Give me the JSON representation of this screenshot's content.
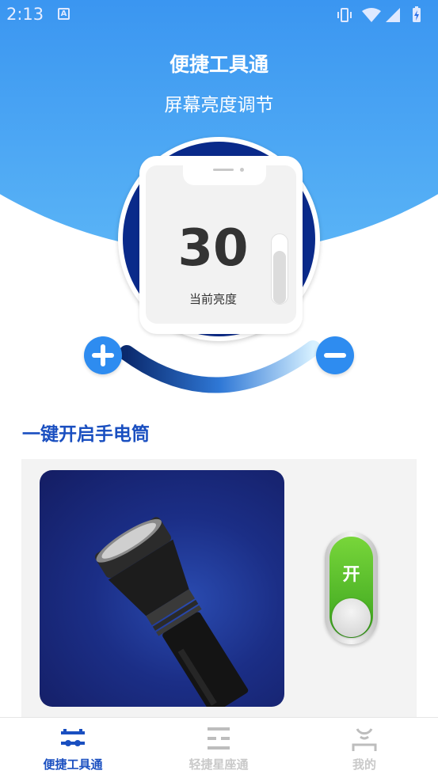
{
  "status_bar": {
    "time": "2:13",
    "notification_icon": "A"
  },
  "header": {
    "title": "便捷工具通",
    "subtitle": "屏幕亮度调节"
  },
  "brightness": {
    "value": "30",
    "label": "当前亮度",
    "level": 0.3
  },
  "controls": {
    "increase_icon": "plus-icon",
    "decrease_icon": "minus-icon"
  },
  "flashlight": {
    "section_title": "一键开启手电筒",
    "switch_label": "开",
    "switch_on": true
  },
  "bottom_nav": {
    "items": [
      {
        "label": "便捷工具通",
        "icon": "toolbox-icon",
        "active": true
      },
      {
        "label": "轻捷星座通",
        "icon": "constellation-icon",
        "active": false
      },
      {
        "label": "我的",
        "icon": "profile-icon",
        "active": false
      }
    ]
  },
  "colors": {
    "accent": "#1a4fc0",
    "header_blue": "#1a66e8",
    "button_blue": "#2e8cf0",
    "switch_green": "#4cb828"
  }
}
